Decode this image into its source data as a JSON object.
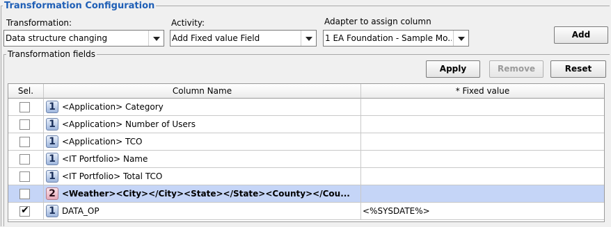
{
  "title": "Transformation Configuration",
  "labels": {
    "transformation": "Transformation:",
    "activity": "Activity:",
    "adapter": "Adapter to assign column"
  },
  "combos": {
    "transformation": "Data structure changing",
    "activity": "Add Fixed value Field",
    "adapter": "1 EA Foundation - Sample Mo..."
  },
  "buttons": {
    "add": "Add",
    "apply": "Apply",
    "remove": "Remove",
    "reset": "Reset"
  },
  "fields_title": "Transformation fields",
  "columns": {
    "sel": "Sel.",
    "name": "Column Name",
    "fixed": "* Fixed value"
  },
  "rows": [
    {
      "num": "1",
      "name": "<Application> Category",
      "fixed": "",
      "checked": false
    },
    {
      "num": "1",
      "name": "<Application> Number of Users",
      "fixed": "",
      "checked": false
    },
    {
      "num": "1",
      "name": "<Application> TCO",
      "fixed": "",
      "checked": false
    },
    {
      "num": "1",
      "name": "<IT Portfolio> Name",
      "fixed": "",
      "checked": false
    },
    {
      "num": "1",
      "name": "<IT Portfolio> Total TCO",
      "fixed": "",
      "checked": false
    },
    {
      "num": "2",
      "name": "<Weather><City></City><State></State><County></Cou...",
      "fixed": "",
      "checked": false
    },
    {
      "num": "1",
      "name": "DATA_OP",
      "fixed": "<%SYSDATE%>",
      "checked": true
    }
  ],
  "checkmark": "✔"
}
